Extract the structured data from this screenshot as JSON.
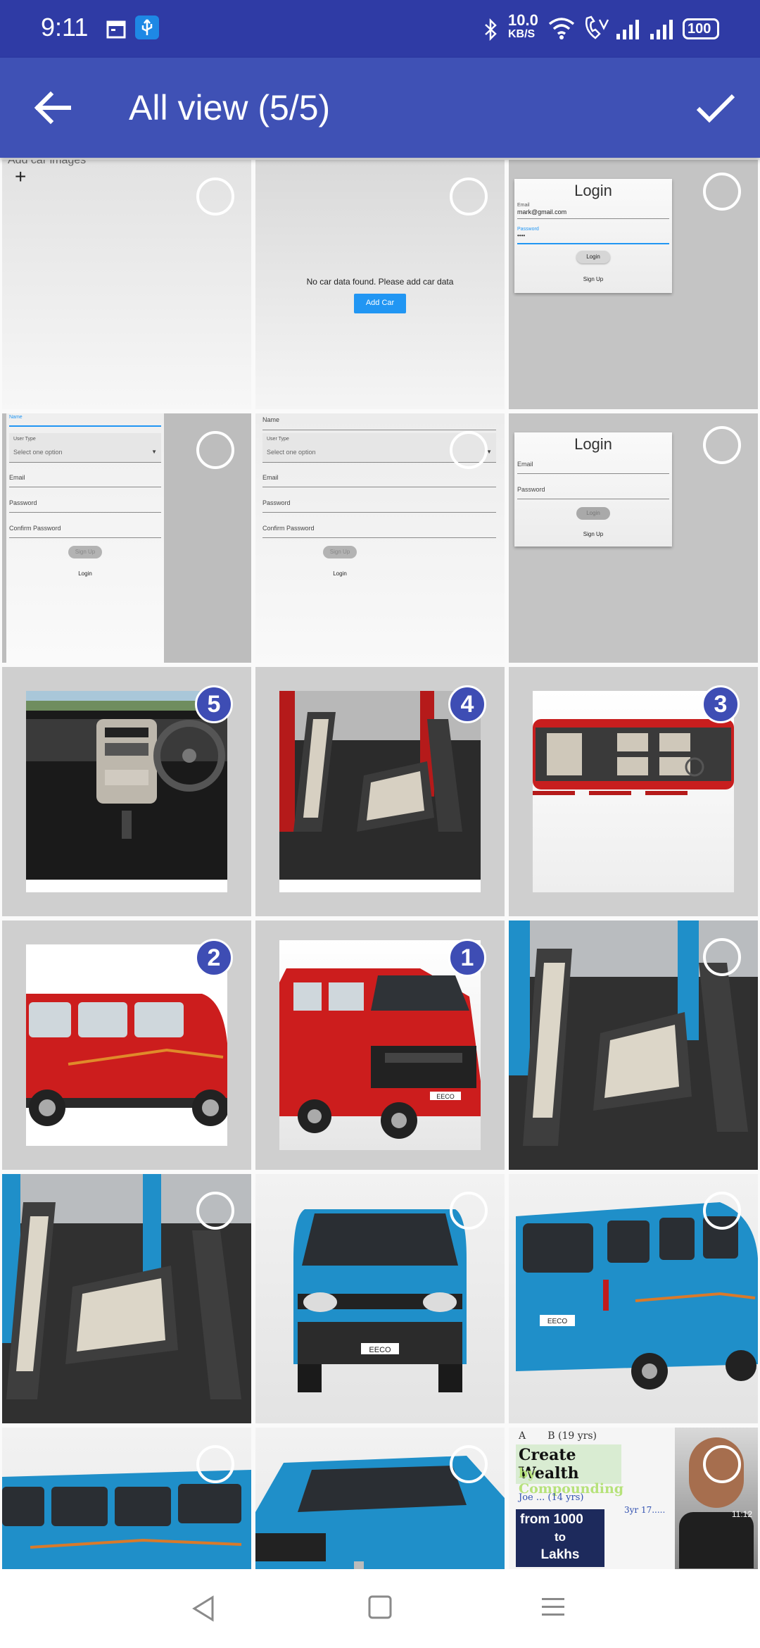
{
  "status_bar": {
    "time": "9:11",
    "network_speed_value": "10.0",
    "network_speed_unit": "KB/S",
    "battery": "100",
    "icons": [
      "calendar-icon",
      "usb-icon",
      "bluetooth-icon",
      "wifi-icon",
      "volte-call-icon",
      "signal-icon",
      "signal-icon",
      "battery-icon"
    ]
  },
  "app_bar": {
    "title": "All view (5/5)",
    "back_icon": "arrow-back-icon",
    "confirm_icon": "check-icon"
  },
  "screens": {
    "add_images": {
      "header_partial": "Add car images",
      "plus": "+"
    },
    "no_data": {
      "message": "No car data found. Please add car data",
      "button": "Add Car"
    },
    "login_filled": {
      "title": "Login",
      "email_label": "Email",
      "email_value": "mark@gmail.com",
      "password_label": "Password",
      "password_value": "••••",
      "login_button": "Login",
      "signup_link": "Sign Up"
    },
    "signup": {
      "name_label": "Name",
      "user_type_label": "User Type",
      "user_type_placeholder": "Select one option",
      "email_label": "Email",
      "password_label": "Password",
      "confirm_label": "Confirm Password",
      "signup_button": "Sign Up",
      "login_link": "Login"
    },
    "login_empty": {
      "title": "Login",
      "email_label": "Email",
      "password_label": "Password",
      "login_button": "Login",
      "signup_link": "Sign Up"
    }
  },
  "selection_badges": [
    "5",
    "4",
    "3",
    "2",
    "1"
  ],
  "thumbnail_text": {
    "wealth_title": "Create Wealth",
    "wealth_sub": "by Compounding",
    "from": "from 1000",
    "to": "to",
    "lakhs": "Lakhs",
    "timestamp": "11:12",
    "eeco_plate": "EECO"
  },
  "nav_bar": {
    "icons": [
      "back-triangle-icon",
      "home-square-icon",
      "menu-lines-icon"
    ]
  },
  "colors": {
    "status_bar": "#2f3ba5",
    "app_bar": "#3f51b5",
    "badge": "#3e4db4",
    "accent_blue": "#2196f3",
    "car_red": "#cc1d1d",
    "car_blue": "#1f8fc9"
  }
}
